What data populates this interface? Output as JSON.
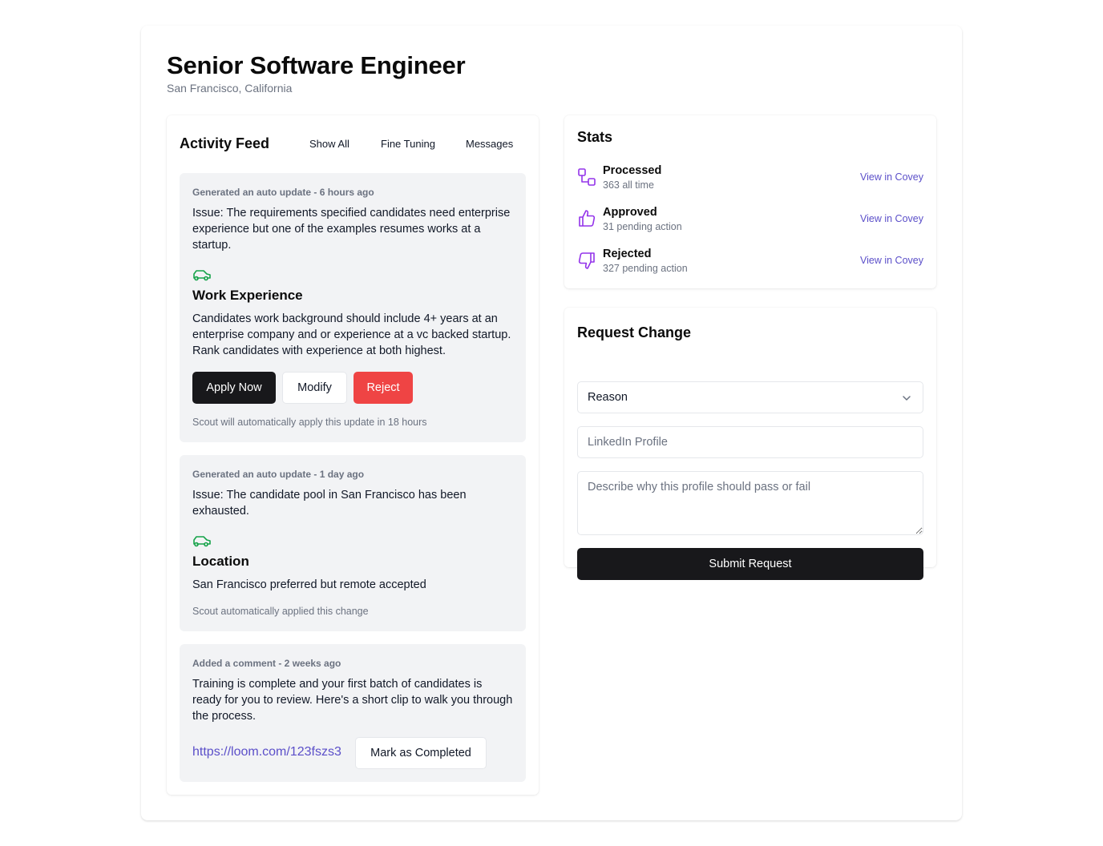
{
  "job": {
    "title": "Senior Software Engineer",
    "location": "San Francisco, California"
  },
  "feed": {
    "title": "Activity Feed",
    "tabs": [
      "Show All",
      "Fine Tuning",
      "Messages"
    ],
    "items": [
      {
        "meta": "Generated an auto update - 6 hours ago",
        "issue": "Issue: The requirements specified candidates need enterprise experience but one of the examples resumes works at a startup.",
        "icon": "car-icon",
        "heading": "Work Experience",
        "description": "Candidates work background should include 4+ years at an enterprise company and or experience at a vc backed startup. Rank candidates with experience at both highest.",
        "buttons": {
          "apply": "Apply Now",
          "modify": "Modify",
          "reject": "Reject"
        },
        "note": "Scout will automatically apply this update in 18 hours"
      },
      {
        "meta": "Generated an auto update - 1 day ago",
        "issue": "Issue: The candidate pool in San Francisco has been exhausted.",
        "icon": "car-icon",
        "heading": "Location",
        "description": "San Francisco preferred but remote accepted",
        "note": "Scout automatically applied this change"
      },
      {
        "meta": "Added a comment - 2 weeks ago",
        "text": "Training is complete and your first batch of candidates is ready for you to review. Here's a short clip to walk you through the process.",
        "link": "https://loom.com/123fszs3",
        "button": "Mark as Completed"
      }
    ]
  },
  "stats": {
    "title": "Stats",
    "rows": [
      {
        "label": "Processed",
        "sub": "363 all time",
        "link": "View in Covey",
        "icon": "flow-icon"
      },
      {
        "label": "Approved",
        "sub": "31 pending action",
        "link": "View in Covey",
        "icon": "thumbs-up-icon"
      },
      {
        "label": "Rejected",
        "sub": "327 pending action",
        "link": "View in Covey",
        "icon": "thumbs-down-icon"
      }
    ]
  },
  "request": {
    "title": "Request Change",
    "reason_value": "Reason",
    "linkedin_placeholder": "LinkedIn Profile",
    "describe_placeholder": "Describe why this profile should pass or fail",
    "submit": "Submit Request"
  },
  "colors": {
    "accent": "#5b4fc9",
    "icon_green": "#16a34a",
    "icon_purple": "#9333ea",
    "reject_red": "#ef4444",
    "dark": "#18181b"
  }
}
